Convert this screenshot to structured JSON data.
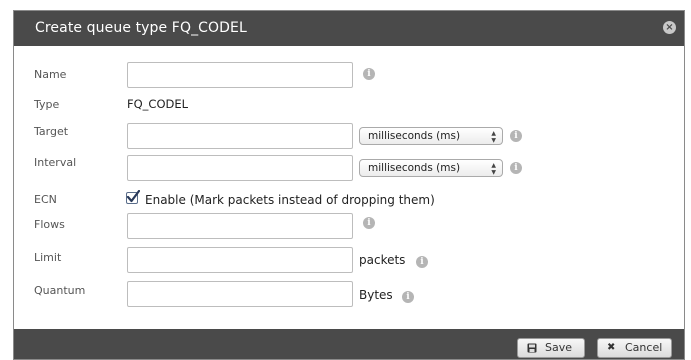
{
  "dialog": {
    "title": "Create queue type FQ_CODEL",
    "close_icon": "close-icon"
  },
  "form": {
    "name": {
      "label": "Name",
      "value": "",
      "placeholder": ""
    },
    "type": {
      "label": "Type",
      "value": "FQ_CODEL"
    },
    "target": {
      "label": "Target",
      "value": "",
      "unit": "milliseconds (ms)"
    },
    "interval": {
      "label": "Interval",
      "value": "",
      "unit": "milliseconds (ms)"
    },
    "ecn": {
      "label": "ECN",
      "checked": true,
      "checkbox_label": "Enable (Mark packets instead of dropping them)"
    },
    "flows": {
      "label": "Flows",
      "value": ""
    },
    "limit": {
      "label": "Limit",
      "value": "",
      "unit": "packets"
    },
    "quantum": {
      "label": "Quantum",
      "value": "",
      "unit": "Bytes"
    }
  },
  "footer": {
    "save_label": "Save",
    "cancel_label": "Cancel"
  },
  "colors": {
    "titlebar": "#4a4a4a",
    "footer": "#4a4a4a",
    "info_icon": "#b5b5b5"
  }
}
